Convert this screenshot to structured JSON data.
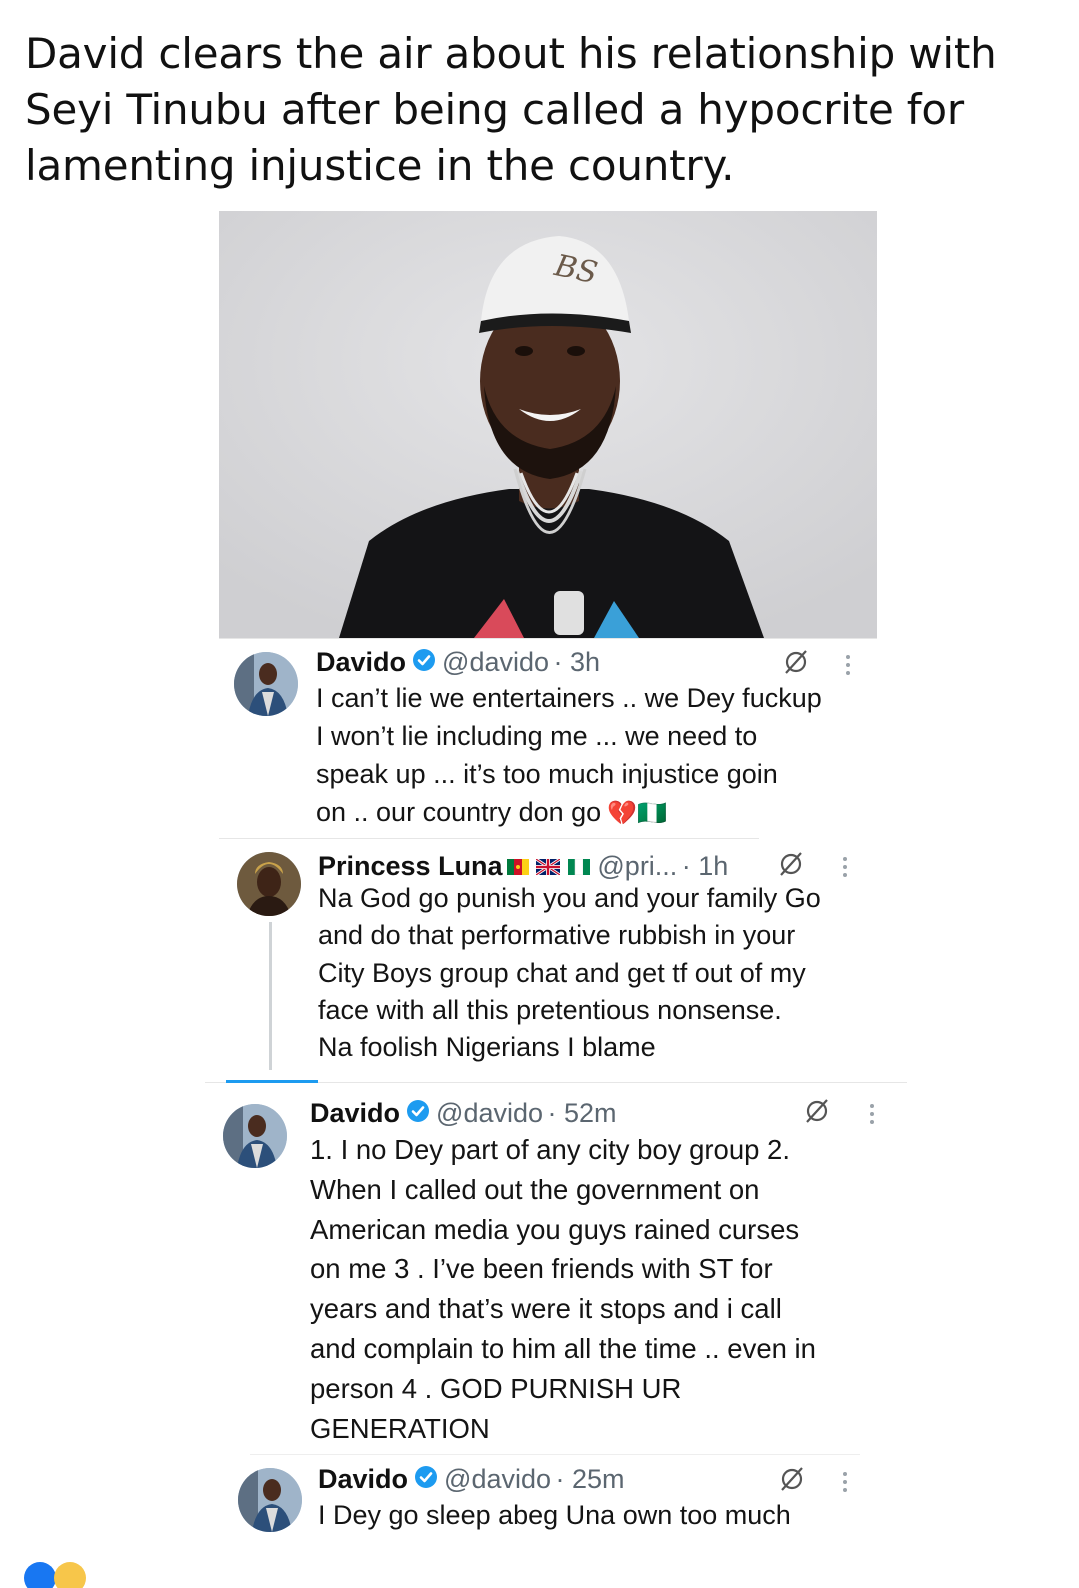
{
  "headline": "David clears the air about his relationship with Seyi Tinubu after being called a hypocrite for lamenting injustice in the country.",
  "photo": {
    "cap_text": "BS"
  },
  "tweets": [
    {
      "name": "Davido",
      "handle": "@davido",
      "time": "· 3h",
      "text": "I can’t lie we entertainers .. we Dey fuckup\nI won’t lie including me ... we need to\nspeak up ... it’s too much injustice goin\non .. our country don go",
      "emoji": "💔🇳🇬"
    },
    {
      "name": "Princess Luna",
      "handle": "@pri...",
      "time": "· 1h",
      "text": "Na God go punish you and your family Go\nand do that performative rubbish in your\nCity Boys group chat and get tf out of my\nface with all this pretentious nonsense.\nNa foolish Nigerians I blame"
    },
    {
      "name": "Davido",
      "handle": "@davido",
      "time": "· 52m",
      "text": "1. I no Dey part of any city boy group 2.\nWhen I called out the government on\nAmerican media you guys rained curses\non me 3 . I’ve been friends with ST for\nyears and that’s were it stops and i call\nand complain to him all the time .. even in\nperson 4 . GOD PURNISH  UR\nGENERATION"
    },
    {
      "name": "Davido",
      "handle": "@davido",
      "time": "· 25m",
      "text": "I Dey go sleep abeg Una own too much"
    }
  ],
  "colors": {
    "verified": "#1d9bf0",
    "handle": "#5b6670",
    "divider": "#e6e6e6",
    "thread_line": "#cfd3d6",
    "selected_tab": "#1d9bf0"
  }
}
